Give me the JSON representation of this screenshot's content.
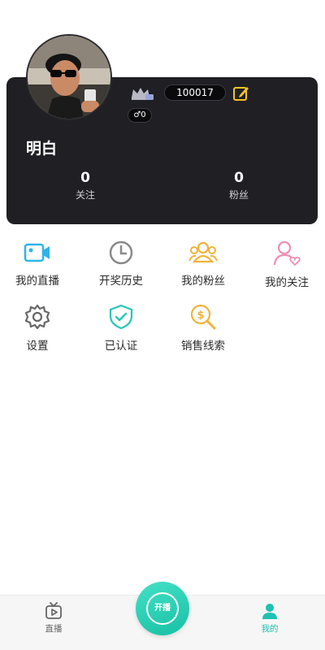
{
  "profile": {
    "id_text": "100017",
    "gender_count": "♂0",
    "username": "明白",
    "stats": [
      {
        "value": "0",
        "label": "关注"
      },
      {
        "value": "0",
        "label": "粉丝"
      }
    ],
    "icons": {
      "crown": "crown-icon",
      "edit": "edit-icon"
    }
  },
  "menu": {
    "row1": [
      {
        "label": "我的直播",
        "icon": "video-camera-icon",
        "color": "#2fb4e6"
      },
      {
        "label": "开奖历史",
        "icon": "clock-icon",
        "color": "#8a8a8a"
      },
      {
        "label": "我的粉丝",
        "icon": "fans-group-icon",
        "color": "#f0b33a"
      },
      {
        "label": "我的关注",
        "icon": "user-heart-icon",
        "color": "#ee8fb3"
      }
    ],
    "row2": [
      {
        "label": "设置",
        "icon": "gear-icon",
        "color": "#666666"
      },
      {
        "label": "已认证",
        "icon": "shield-check-icon",
        "color": "#25c7b6"
      },
      {
        "label": "销售线索",
        "icon": "money-search-icon",
        "color": "#f0b33a"
      }
    ]
  },
  "bottom_nav": {
    "live_label": "直播",
    "go_live_label": "开播",
    "mine_label": "我的",
    "active_color": "#1ec2b0",
    "inactive_color": "#666666"
  }
}
